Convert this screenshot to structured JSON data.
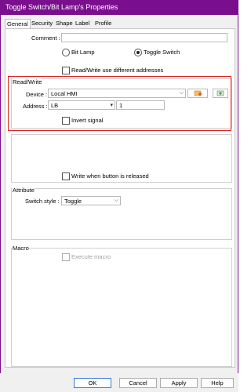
{
  "window": {
    "title": "Toggle Switch/Bit Lamp's Properties"
  },
  "tabs": [
    {
      "label": "General"
    },
    {
      "label": "Security"
    },
    {
      "label": "Shape"
    },
    {
      "label": "Label"
    },
    {
      "label": "Profile"
    }
  ],
  "general": {
    "comment_label": "Comment :",
    "comment_value": "",
    "mode_options": [
      {
        "label": "Bit Lamp",
        "selected": false
      },
      {
        "label": "Toggle Switch",
        "selected": true
      }
    ],
    "rw_different_label": "Read/Write use different addresses",
    "rw_different_checked": false
  },
  "read_write": {
    "title": "Read/Write",
    "device_label": "Device :",
    "device_value": "Local HMI",
    "address_label": "Address :",
    "address_type": "LB",
    "address_value": "1",
    "invert_label": "Invert signal",
    "invert_checked": false
  },
  "write_release": {
    "label": "Write when button is released",
    "checked": false
  },
  "attribute": {
    "title": "Attribute",
    "switch_style_label": "Switch style :",
    "switch_style_value": "Toggle"
  },
  "macro": {
    "title": "Macro",
    "execute_label": "Execute macro",
    "enabled": false
  },
  "buttons": {
    "ok": "OK",
    "cancel": "Cancel",
    "apply": "Apply",
    "help": "Help"
  }
}
